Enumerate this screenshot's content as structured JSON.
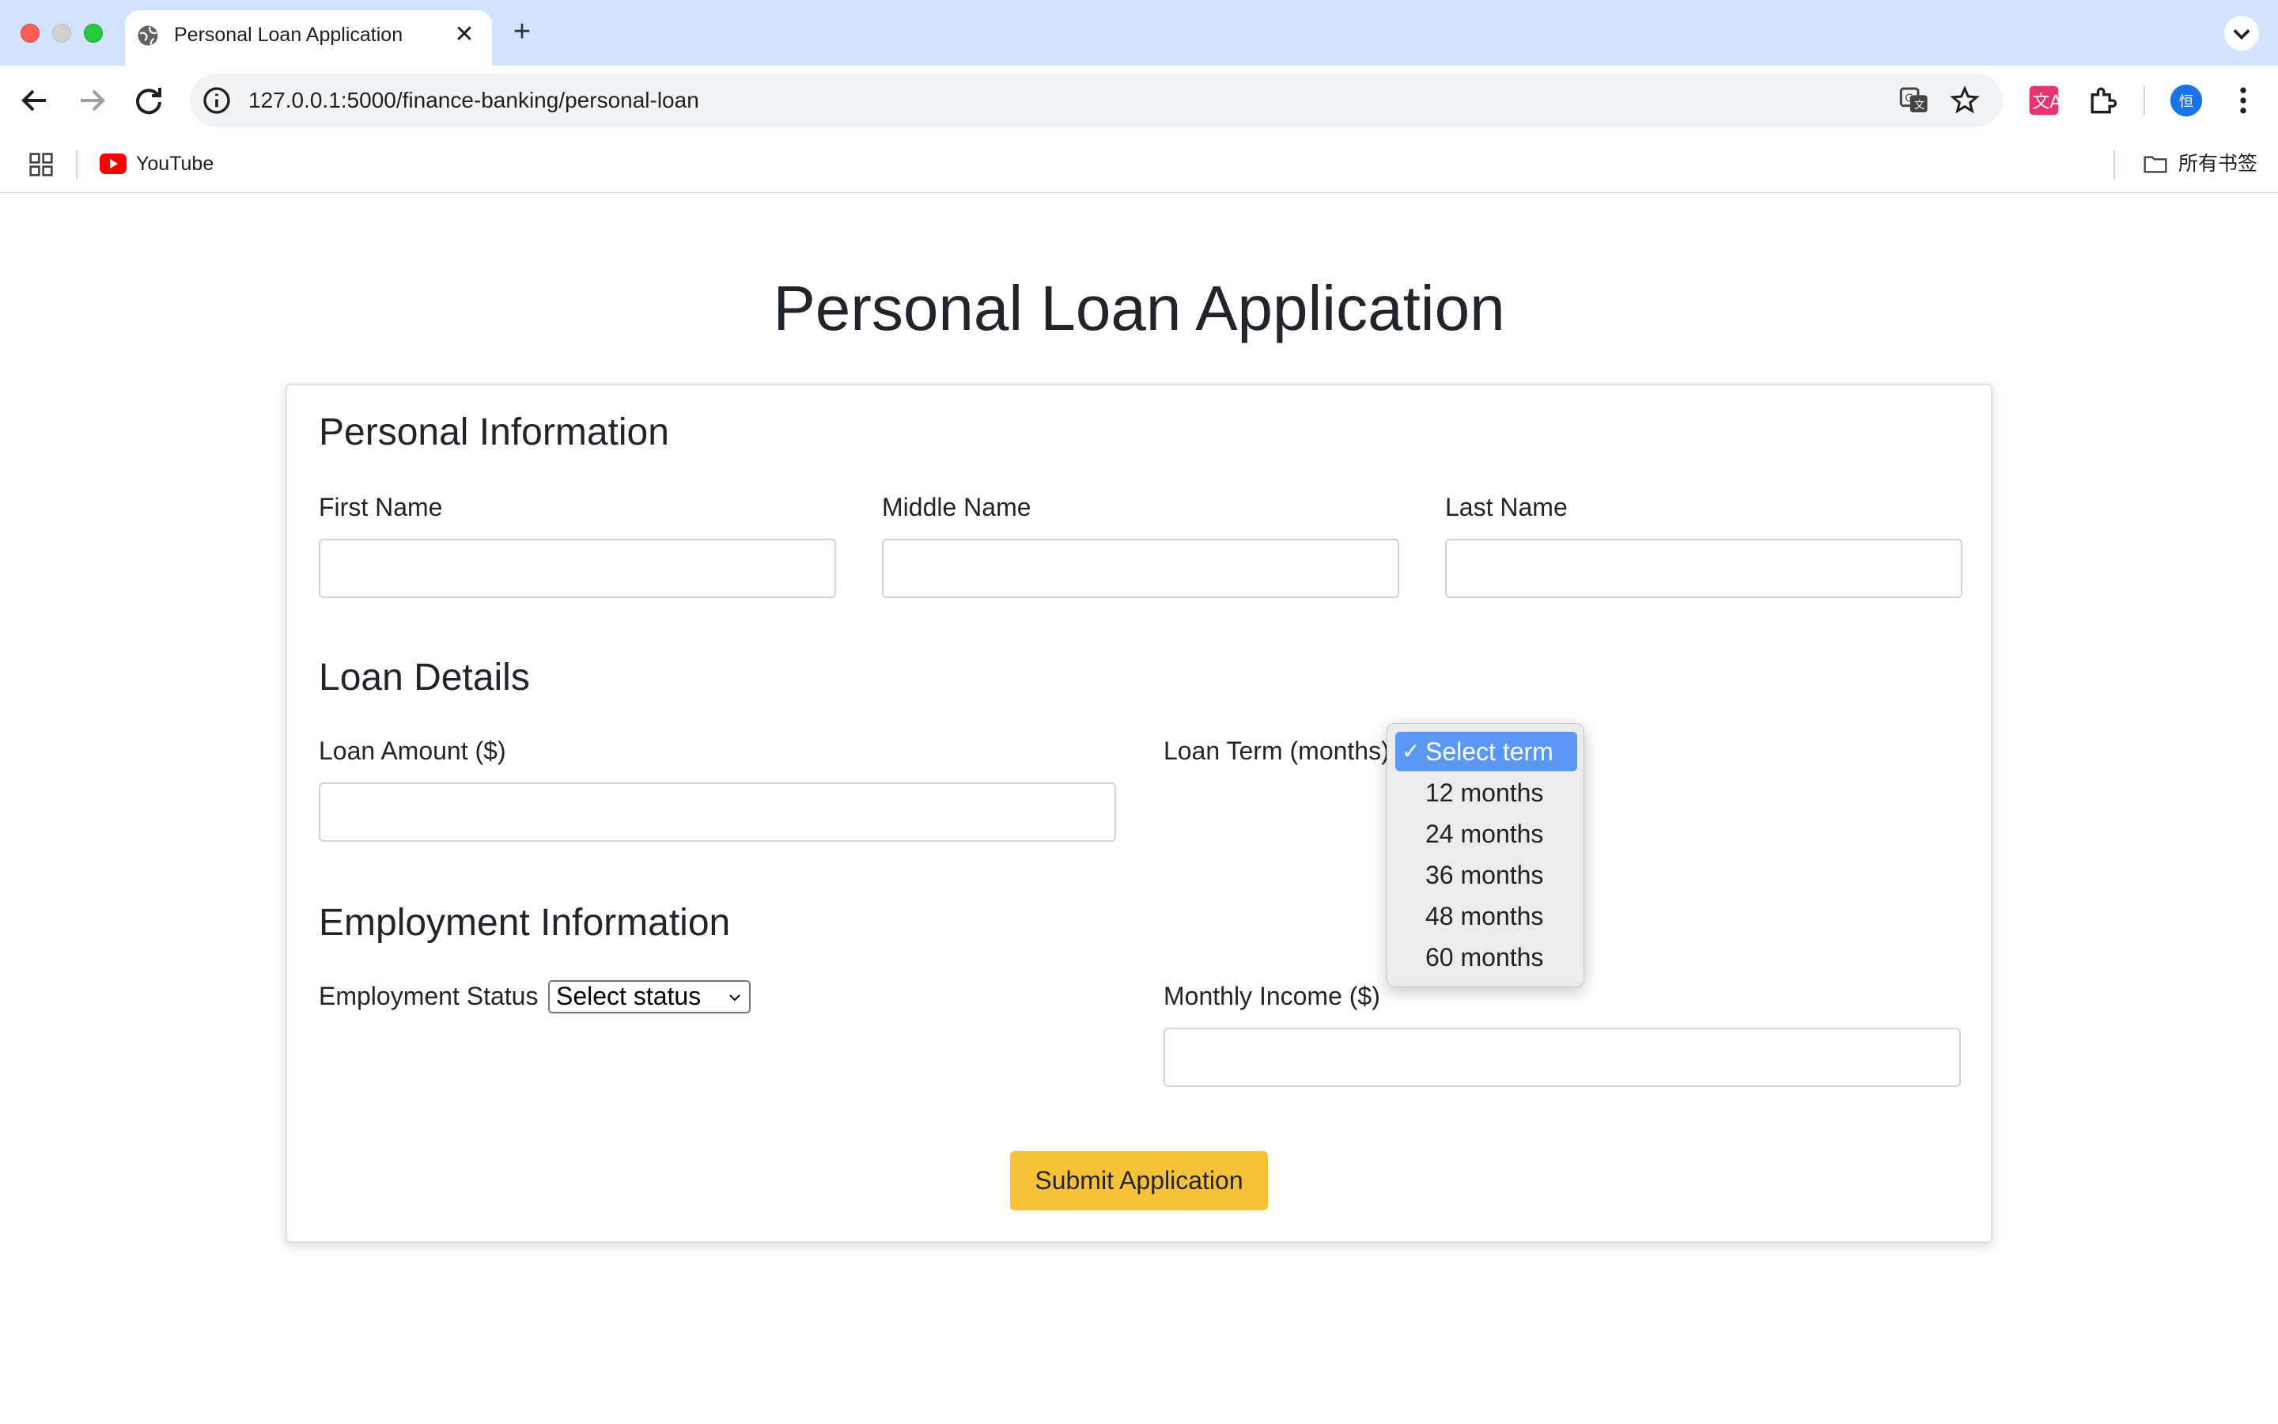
{
  "browser": {
    "tab_title": "Personal Loan Application",
    "new_tab": "+",
    "close_glyph": "✕",
    "url": "127.0.0.1:5000/finance-banking/personal-loan",
    "bookmarks": [
      {
        "label": "YouTube",
        "icon": "youtube-icon"
      }
    ],
    "all_bookmarks_label": "所有书签",
    "profile_initial": "恒"
  },
  "page": {
    "title": "Personal Loan Application",
    "sections": {
      "personal": "Personal Information",
      "loan": "Loan Details",
      "employment": "Employment Information"
    },
    "fields": {
      "first_name": {
        "label": "First Name",
        "value": ""
      },
      "middle_name": {
        "label": "Middle Name",
        "value": ""
      },
      "last_name": {
        "label": "Last Name",
        "value": ""
      },
      "loan_amount": {
        "label": "Loan Amount ($)",
        "value": ""
      },
      "loan_term": {
        "label": "Loan Term (months)",
        "selected": "Select term"
      },
      "employment_status": {
        "label": "Employment Status",
        "selected": "Select status"
      },
      "monthly_income": {
        "label": "Monthly Income ($)",
        "value": ""
      }
    },
    "submit_label": "Submit Application"
  },
  "loan_term_dropdown": {
    "check": "✓",
    "options": [
      "Select term",
      "12 months",
      "24 months",
      "36 months",
      "48 months",
      "60 months"
    ]
  },
  "colors": {
    "tabbar_bg": "#d3e3fd",
    "submit_bg": "#f8c13a",
    "dropdown_selected": "#5b97f5"
  }
}
